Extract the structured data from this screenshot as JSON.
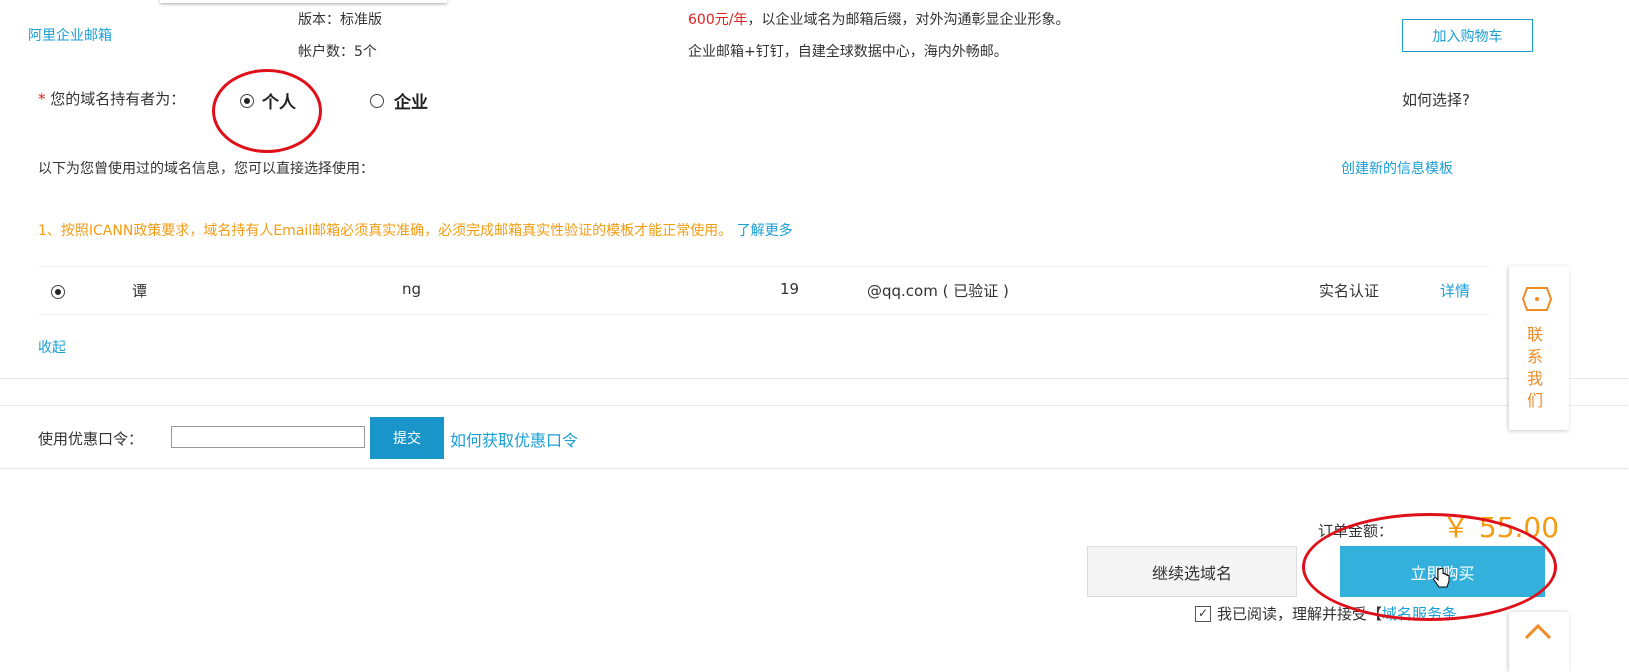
{
  "product": {
    "name": "阿里企业邮箱",
    "version": "版本：标准版",
    "accounts": "帐户数：5个",
    "price": "600元/年",
    "desc1": "，以企业域名为邮箱后缀，对外沟通彰显企业形象。",
    "desc2": "企业邮箱+钉钉，自建全球数据中心，海内外畅邮。",
    "add_cart": "加入购物车"
  },
  "holder": {
    "required": "*",
    "label": "您的域名持有者为：",
    "opt_personal": "个人",
    "opt_company": "企业",
    "how_choose": "如何选择?",
    "history_note": "以下为您曾使用过的域名信息，您可以直接选择使用：",
    "create_template": "创建新的信息模板",
    "icann_notice": "1、按照ICANN政策要求，域名持有人Email邮箱必须真实准确，必须完成邮箱真实性验证的模板才能正常使用。",
    "learn_more": "了解更多",
    "row": {
      "name": "谭",
      "name2": "ng",
      "phone": "19",
      "email": "@qq.com ( 已验证 )",
      "realname": "实名认证",
      "details": "详情"
    },
    "collapse": "收起"
  },
  "coupon": {
    "label": "使用优惠口令：",
    "input_value": "",
    "submit": "提交",
    "how_get": "如何获取优惠口令"
  },
  "order": {
    "amount_label": "订单金额：",
    "amount": "￥ 55.00",
    "continue": "继续选域名",
    "buy_now": "立即购买",
    "agree": "我已阅读，理解并接受【",
    "terms": "域名服务条"
  },
  "side": {
    "contact": "联系我们"
  },
  "colors": {
    "accent": "#1a9fd5",
    "orange": "#f39c12",
    "annotation": "#e0101a",
    "button": "#33b0dc"
  }
}
